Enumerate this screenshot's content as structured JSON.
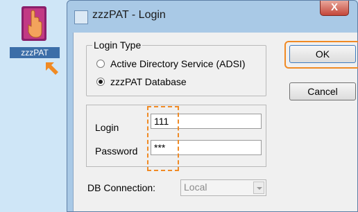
{
  "desktop": {
    "icon_label": "zzzPAT"
  },
  "window": {
    "title": "zzzPAT - Login",
    "close_label": "X"
  },
  "login_type": {
    "legend": "Login Type",
    "options": [
      {
        "label": "Active Directory Service (ADSI)",
        "selected": false
      },
      {
        "label": "zzzPAT Database",
        "selected": true
      }
    ]
  },
  "buttons": {
    "ok": "OK",
    "cancel": "Cancel"
  },
  "credentials": {
    "login_label": "Login",
    "login_value": "111",
    "password_label": "Password",
    "password_value": "***"
  },
  "db_connection": {
    "label": "DB Connection:",
    "value": "Local"
  },
  "colors": {
    "highlight": "#f08a24",
    "desktop": "#cfe6f7"
  }
}
